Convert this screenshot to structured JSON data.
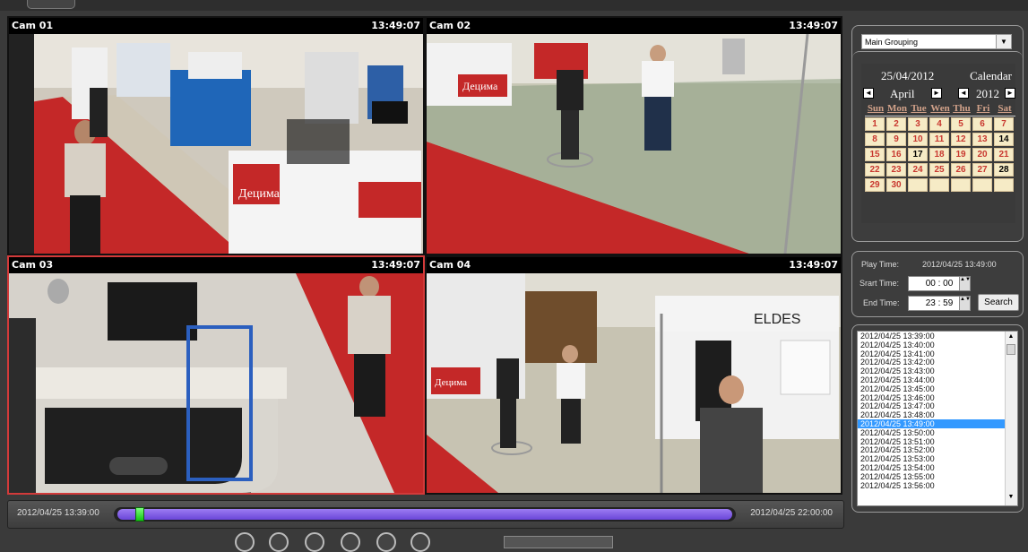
{
  "cams": [
    {
      "name": "Cam 01",
      "time": "13:49:07"
    },
    {
      "name": "Cam 02",
      "time": "13:49:07"
    },
    {
      "name": "Cam 03",
      "time": "13:49:07"
    },
    {
      "name": "Cam 04",
      "time": "13:49:07"
    }
  ],
  "scenes": {
    "cam1_sign": "Децима",
    "cam2_sign": "Децима",
    "cam4_sign": "ELDES",
    "cam4_sign2": "Децима"
  },
  "timeline": {
    "start": "2012/04/25 13:39:00",
    "end": "2012/04/25 22:00:00",
    "position_fraction": 0.035
  },
  "group_select": {
    "value": "Main Grouping",
    "arrow": "▼"
  },
  "calendar": {
    "date": "25/04/2012",
    "title": "Calendar",
    "month": "April",
    "year": "2012",
    "prev": "◄",
    "next": "►",
    "days": [
      "Sun",
      "Mon",
      "Tue",
      "Wen",
      "Thu",
      "Fri",
      "Sat"
    ],
    "weeks": [
      [
        "1",
        "2",
        "3",
        "4",
        "5",
        "6",
        "7"
      ],
      [
        "8",
        "9",
        "10",
        "11",
        "12",
        "13",
        "14"
      ],
      [
        "15",
        "16",
        "17",
        "18",
        "19",
        "20",
        "21"
      ],
      [
        "22",
        "23",
        "24",
        "25",
        "26",
        "27",
        "28"
      ],
      [
        "29",
        "30",
        "",
        "",
        "",
        "",
        ""
      ]
    ],
    "plain_days": [
      "14",
      "17",
      "28"
    ]
  },
  "time_panel": {
    "play_label": "Play Time:",
    "play_value": "2012/04/25 13:49:00",
    "start_label": "Srart Time:",
    "start_value": "00 : 00",
    "end_label": "End Time:",
    "end_value": "23 : 59",
    "search_label": "Search",
    "spin": "▲▼"
  },
  "recordings": [
    "2012/04/25 13:39:00",
    "2012/04/25 13:40:00",
    "2012/04/25 13:41:00",
    "2012/04/25 13:42:00",
    "2012/04/25 13:43:00",
    "2012/04/25 13:44:00",
    "2012/04/25 13:45:00",
    "2012/04/25 13:46:00",
    "2012/04/25 13:47:00",
    "2012/04/25 13:48:00",
    "2012/04/25 13:49:00",
    "2012/04/25 13:50:00",
    "2012/04/25 13:51:00",
    "2012/04/25 13:52:00",
    "2012/04/25 13:53:00",
    "2012/04/25 13:54:00",
    "2012/04/25 13:55:00",
    "2012/04/25 13:56:00"
  ],
  "selected_recording": 10,
  "scroll": {
    "up": "▲",
    "down": "▼"
  }
}
